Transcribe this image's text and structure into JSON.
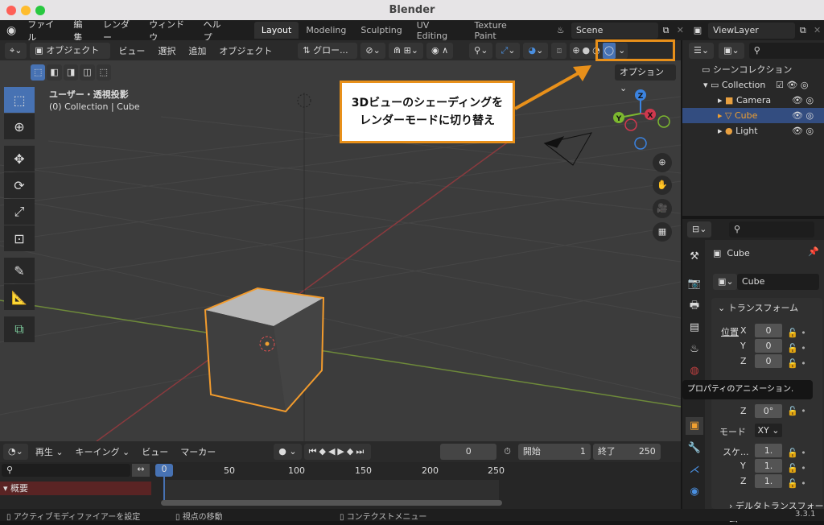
{
  "window": {
    "title": "Blender"
  },
  "menus": [
    "ファイル",
    "編集",
    "レンダー",
    "ウィンドウ",
    "ヘルプ"
  ],
  "workspaces": [
    {
      "label": "Layout",
      "active": true
    },
    {
      "label": "Modeling"
    },
    {
      "label": "Sculpting"
    },
    {
      "label": "UV Editing"
    },
    {
      "label": "Texture Paint"
    }
  ],
  "scene": {
    "name": "Scene",
    "view_layer": "ViewLayer"
  },
  "viewport_header": {
    "mode": "オブジェクト",
    "menus": [
      "ビュー",
      "選択",
      "追加",
      "オブジェクト"
    ],
    "transform_orientation": "グロー...",
    "options": "オプション",
    "shading_modes": [
      "wireframe",
      "solid",
      "material-preview",
      "rendered"
    ],
    "active_shading": "rendered"
  },
  "viewport": {
    "view_name": "ユーザー・透視投影",
    "context": "(0) Collection | Cube",
    "gizmo_axes": [
      "Z",
      "X",
      "Y"
    ]
  },
  "callout": {
    "line1": "3Dビューのシェーディングを",
    "line2": "レンダーモードに切り替え",
    "color": "#e8901a"
  },
  "outliner": {
    "root": "シーンコレクション",
    "items": [
      {
        "label": "Collection"
      },
      {
        "label": "Camera"
      },
      {
        "label": "Cube",
        "selected": true
      },
      {
        "label": "Light"
      }
    ]
  },
  "properties": {
    "object_name": "Cube",
    "data_name": "Cube",
    "panel": "トランスフォーム",
    "location_label": "位置",
    "loc": [
      "0",
      "0",
      "0"
    ],
    "rot_z": "0°",
    "mode_label": "モード",
    "mode": "XY",
    "scale_label": "スケ...",
    "scale": [
      "1.",
      "1.",
      "1."
    ],
    "delta": "デルタトランスフォーム",
    "axes": [
      "X",
      "Y",
      "Z"
    ],
    "tooltip": "プロパティのアニメーション."
  },
  "timeline": {
    "menus": [
      "再生",
      "キーイング",
      "ビュー",
      "マーカー"
    ],
    "current_frame": "0",
    "start_label": "開始",
    "start": "1",
    "end_label": "終了",
    "end": "250",
    "ticks": [
      "0",
      "50",
      "100",
      "150",
      "200",
      "250"
    ],
    "summary": "概要"
  },
  "status": {
    "left": "アクティブモディファイアーを設定",
    "middle": "視点の移動",
    "right": "コンテクストメニュー",
    "version": "3.3.1"
  }
}
